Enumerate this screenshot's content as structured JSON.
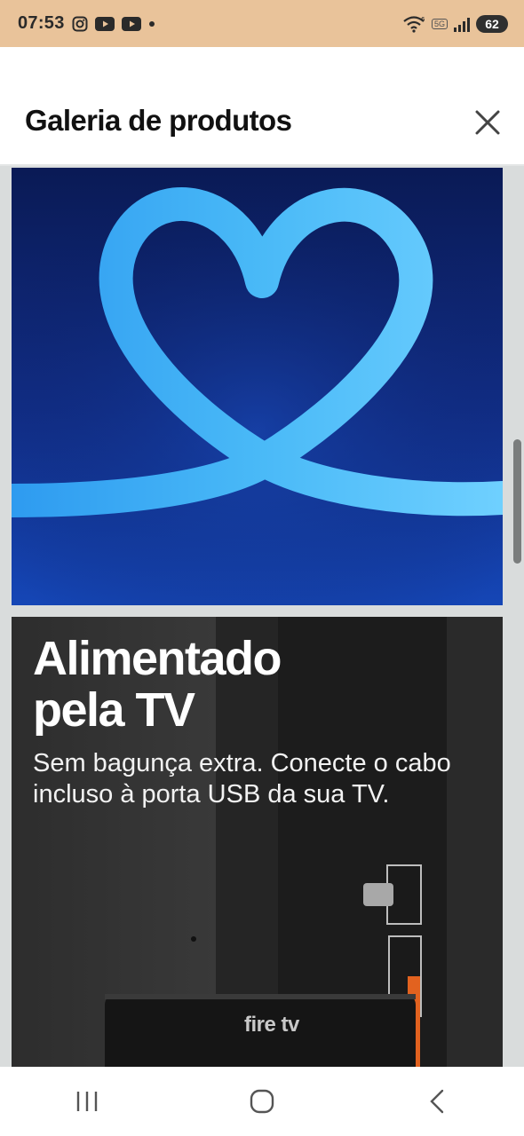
{
  "status_bar": {
    "time": "07:53",
    "network": "5G",
    "battery": "62"
  },
  "header": {
    "title": "Galeria de produtos",
    "close_icon": "close-icon"
  },
  "gallery": {
    "images": [
      {
        "description_icon": "heart-icon"
      },
      {
        "headline": "Alimentado pela TV",
        "body": "Sem bagunça extra. Conecte o cabo incluso à porta USB da sua TV.",
        "device_logo": "fire tv"
      }
    ]
  },
  "colors": {
    "status_bar_bg": "#e9c39a",
    "heart": "#48b8f5",
    "card1_bg": "#112d86"
  },
  "nav": {
    "icons": [
      "recent-apps-icon",
      "home-icon",
      "back-icon"
    ]
  }
}
